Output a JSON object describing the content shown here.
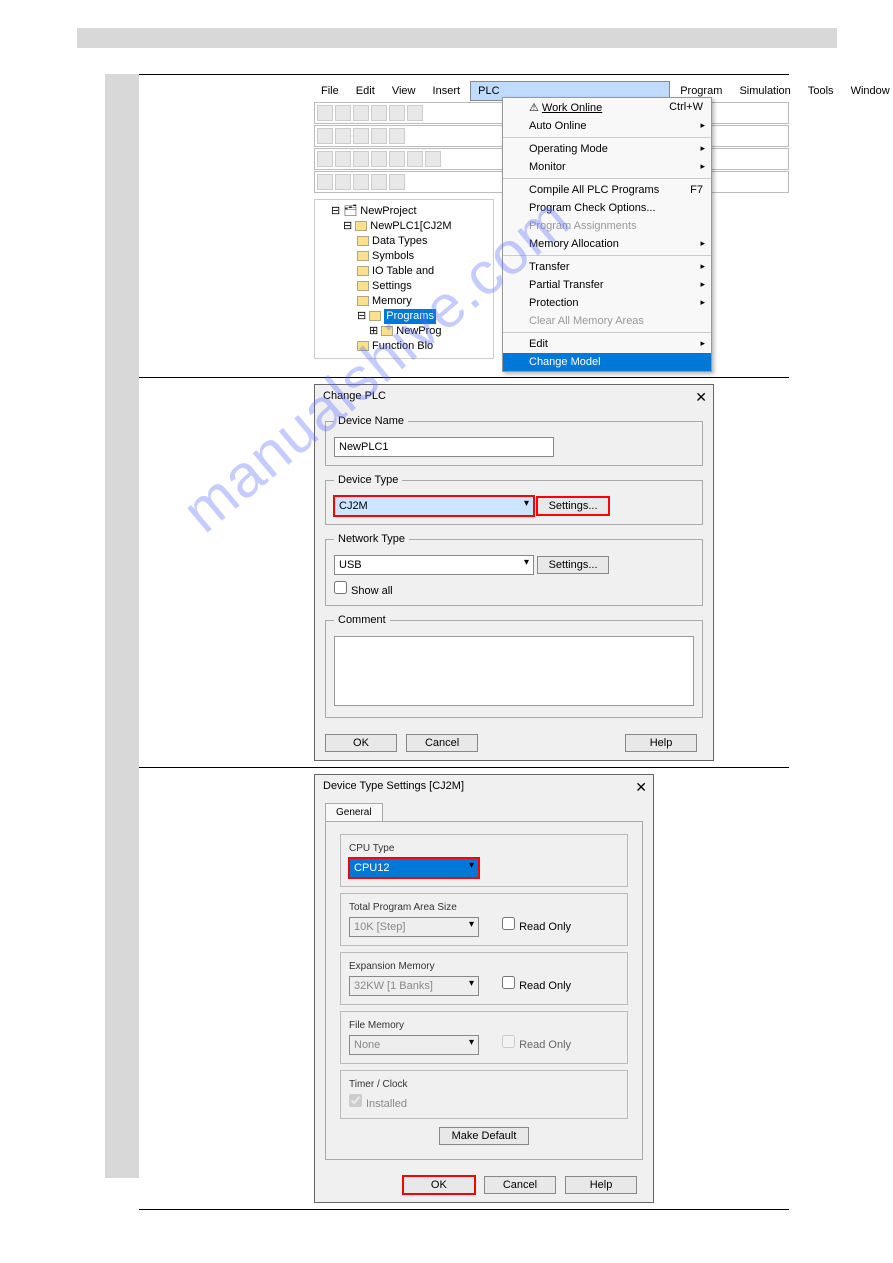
{
  "watermark": "manualshive.com",
  "menubar": [
    "File",
    "Edit",
    "View",
    "Insert",
    "PLC",
    "Program",
    "Simulation",
    "Tools",
    "Window"
  ],
  "plc_menu": {
    "work_online": "Work Online",
    "work_online_sc": "Ctrl+W",
    "auto_online": "Auto Online",
    "operating": "Operating Mode",
    "monitor": "Monitor",
    "compile": "Compile All PLC Programs",
    "compile_sc": "F7",
    "check": "Program Check Options...",
    "assign": "Program Assignments",
    "memalloc": "Memory Allocation",
    "transfer": "Transfer",
    "partial": "Partial Transfer",
    "protection": "Protection",
    "clear": "Clear All Memory Areas",
    "edit": "Edit",
    "change": "Change Model"
  },
  "tree": {
    "root": "NewProject",
    "plc": "NewPLC1[CJ2M",
    "items": [
      "Data Types",
      "Symbols",
      "IO Table and",
      "Settings",
      "Memory",
      "Programs",
      "NewProg",
      "Function Blo"
    ]
  },
  "dlg2": {
    "title": "Change PLC",
    "g1": "Device Name",
    "v1": "NewPLC1",
    "g2": "Device Type",
    "v2": "CJ2M",
    "b2": "Settings...",
    "g3": "Network Type",
    "v3": "USB",
    "b3": "Settings...",
    "show": "Show all",
    "g4": "Comment",
    "ok": "OK",
    "cancel": "Cancel",
    "help": "Help"
  },
  "dlg3": {
    "title": "Device Type Settings [CJ2M]",
    "tab": "General",
    "cpu_l": "CPU Type",
    "cpu_v": "CPU12",
    "area_l": "Total Program Area Size",
    "area_v": "10K [Step]",
    "exp_l": "Expansion Memory",
    "exp_v": "32KW [1 Banks]",
    "file_l": "File Memory",
    "file_v": "None",
    "tim_l": "Timer / Clock",
    "tim_v": "Installed",
    "ro": "Read Only",
    "make": "Make Default",
    "ok": "OK",
    "cancel": "Cancel",
    "help": "Help"
  }
}
